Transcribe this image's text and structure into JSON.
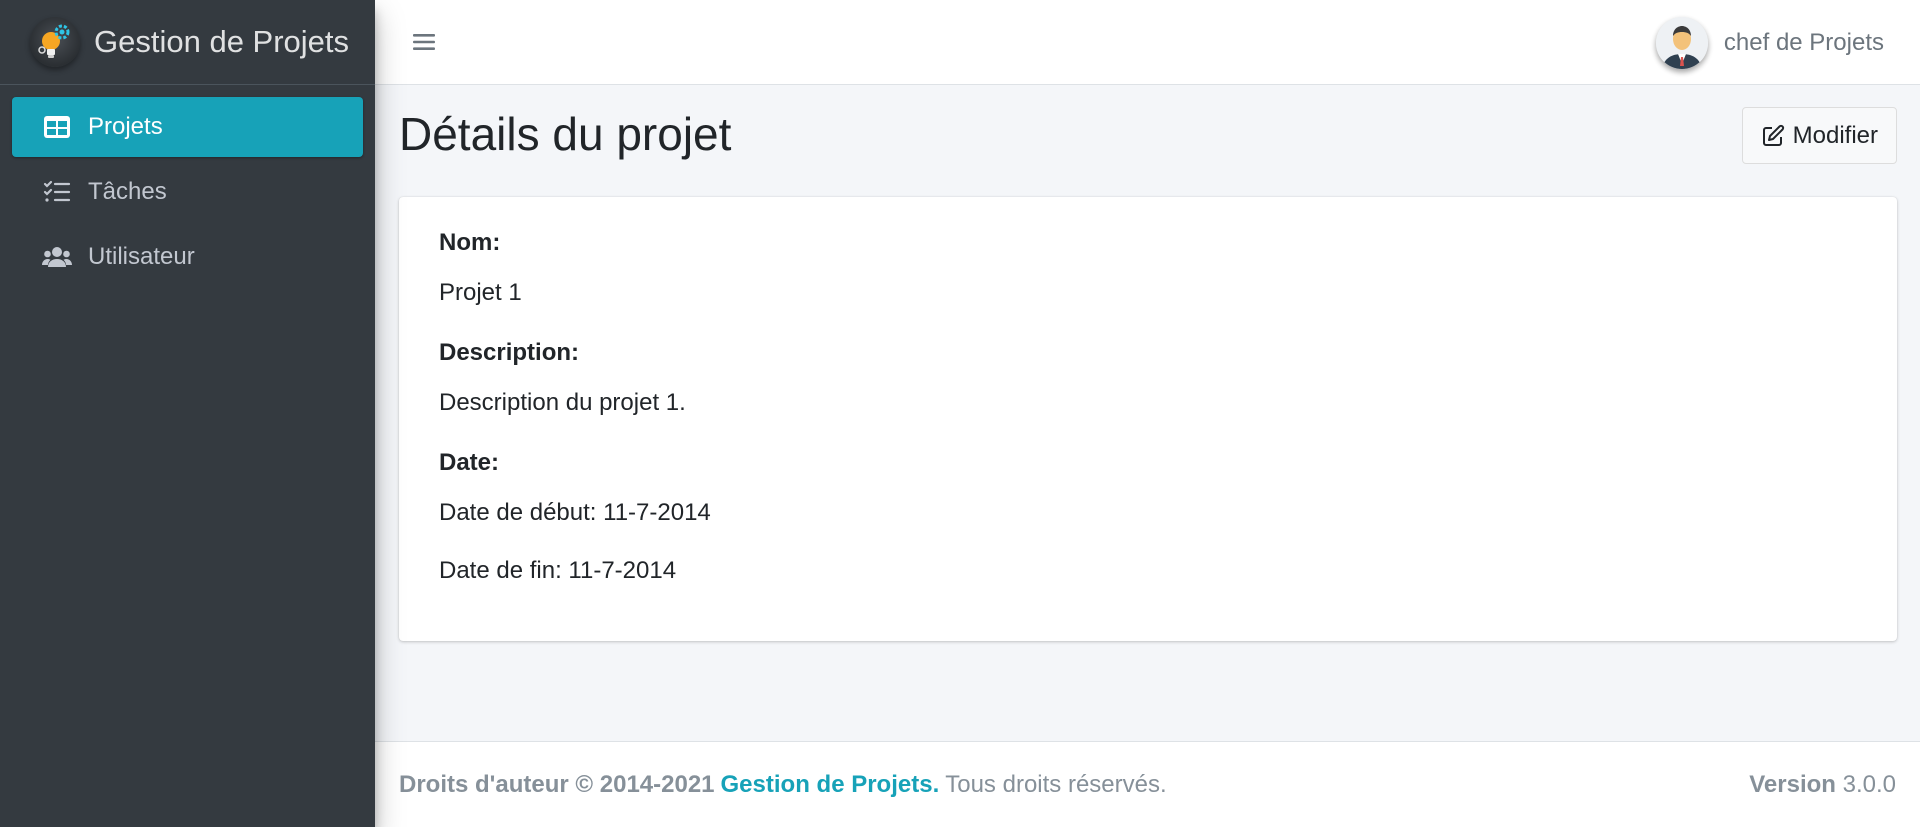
{
  "brand": {
    "name": "Gestion de Projets",
    "logo_icon": "lightbulb-gears-icon"
  },
  "sidebar": {
    "items": [
      {
        "label": "Projets",
        "icon": "table-icon",
        "active": true
      },
      {
        "label": "Tâches",
        "icon": "tasks-icon",
        "active": false
      },
      {
        "label": "Utilisateur",
        "icon": "users-icon",
        "active": false
      }
    ]
  },
  "topbar": {
    "menu_icon": "hamburger-icon",
    "user_name": "chef de Projets",
    "avatar_icon": "user-avatar-icon"
  },
  "page": {
    "title": "Détails du projet",
    "edit_label": "Modifier",
    "edit_icon": "edit-icon"
  },
  "project": {
    "name_label": "Nom:",
    "name": "Projet 1",
    "description_label": "Description:",
    "description": "Description du projet 1.",
    "date_label": "Date:",
    "start": "Date de début: 11-7-2014",
    "end": "Date de fin: 11-7-2014"
  },
  "footer": {
    "copyright": "Droits d'auteur © 2014-2021",
    "link": "Gestion de Projets.",
    "rights": "Tous droits réservés.",
    "version_label": "Version",
    "version": "3.0.0"
  },
  "colors": {
    "sidebar": "#343a40",
    "accent": "#17a2b8",
    "background": "#f4f6f9"
  }
}
